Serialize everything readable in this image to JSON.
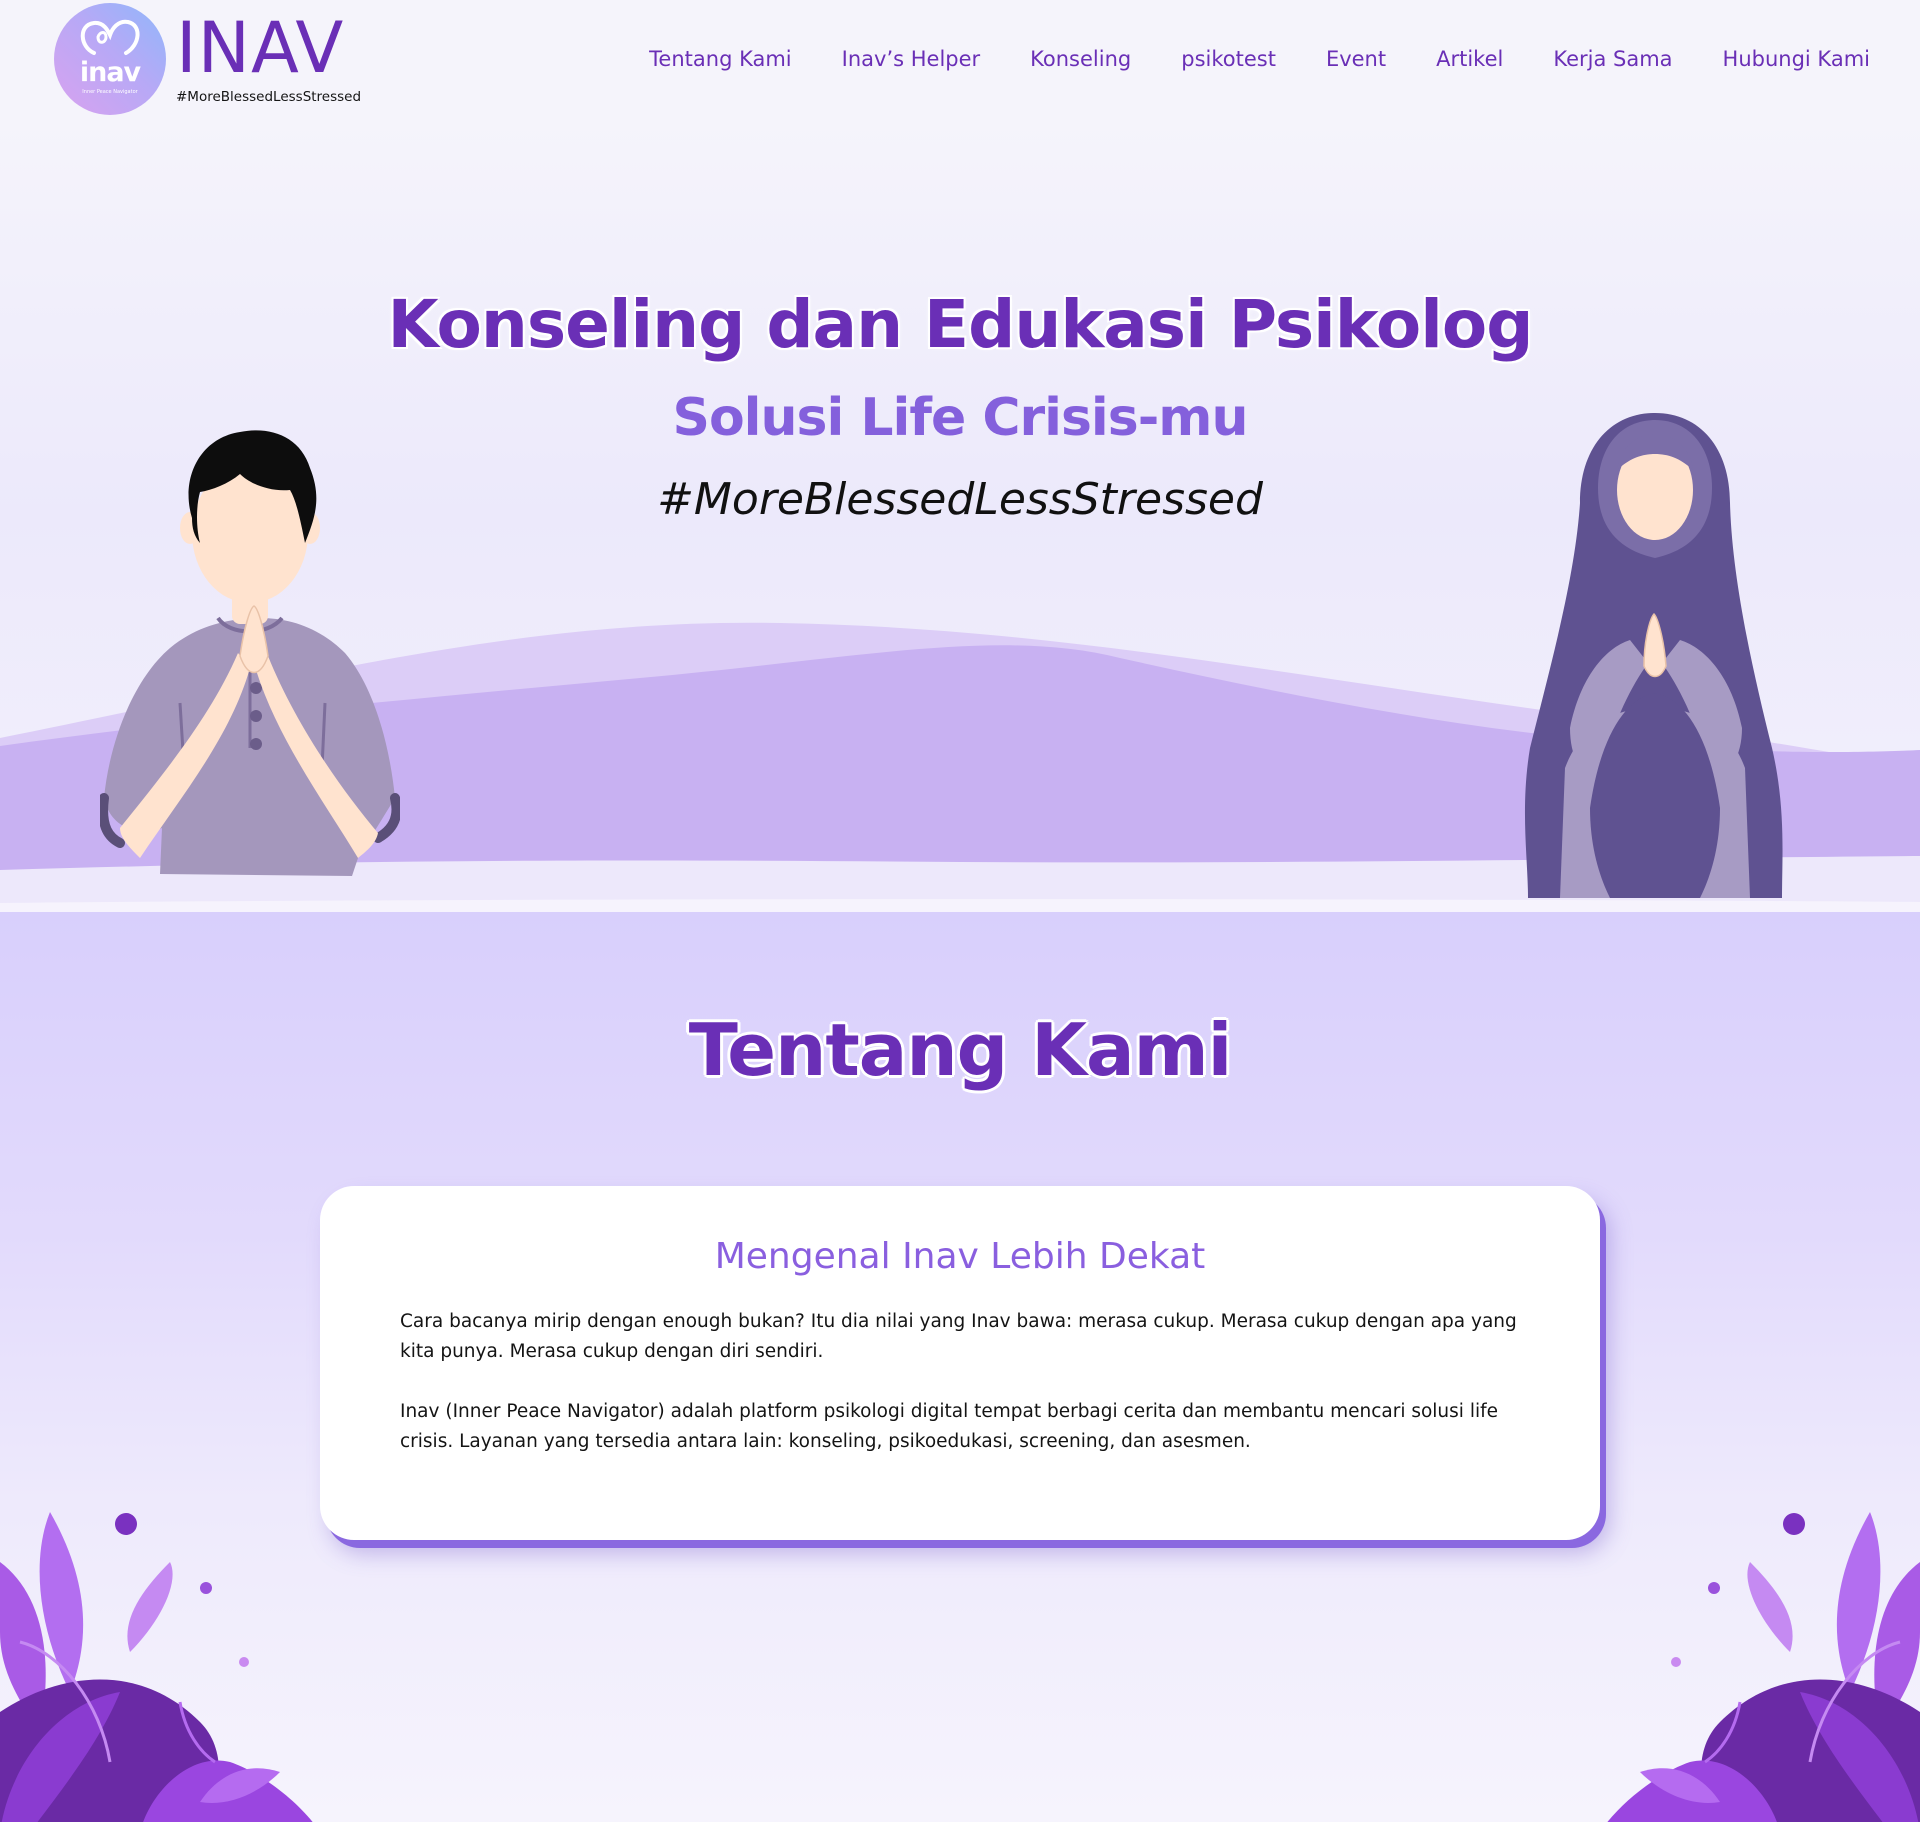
{
  "header": {
    "logo_mark_text": "inav",
    "logo_subtext": "Inner Peace Navigator",
    "brand_title": "INAV",
    "brand_tagline": "#MoreBlessedLessStressed",
    "nav": [
      {
        "label": "Tentang Kami"
      },
      {
        "label": "Inav’s Helper"
      },
      {
        "label": "Konseling"
      },
      {
        "label": "psikotest"
      },
      {
        "label": "Event"
      },
      {
        "label": "Artikel"
      },
      {
        "label": "Kerja Sama"
      },
      {
        "label": "Hubungi Kami"
      }
    ]
  },
  "hero": {
    "title": "Konseling dan Edukasi Psikolog",
    "subtitle": "Solusi Life Crisis-mu",
    "tagline": "#MoreBlessedLessStressed",
    "illustrations": [
      "man-greeting-illustration",
      "woman-greeting-illustration"
    ]
  },
  "about": {
    "title": "Tentang Kami",
    "card": {
      "heading": "Mengenal Inav Lebih Dekat",
      "paragraphs": [
        "Cara bacanya mirip dengan enough bukan? Itu dia nilai yang Inav bawa: merasa cukup. Merasa cukup dengan apa yang kita punya. Merasa cukup dengan diri sendiri.",
        "Inav (Inner Peace Navigator) adalah platform psikologi digital tempat berbagi cerita dan membantu mencari solusi life crisis. Layanan yang tersedia antara lain: konseling, psikoedukasi, screening, dan asesmen."
      ]
    }
  },
  "colors": {
    "brand_purple": "#6a2fb6",
    "accent_purple": "#8460dc",
    "wave_light": "#dccdf7",
    "wave_mid": "#c6b0f2",
    "leaf_dark": "#6a2aa5",
    "leaf_bright": "#a046e6"
  }
}
